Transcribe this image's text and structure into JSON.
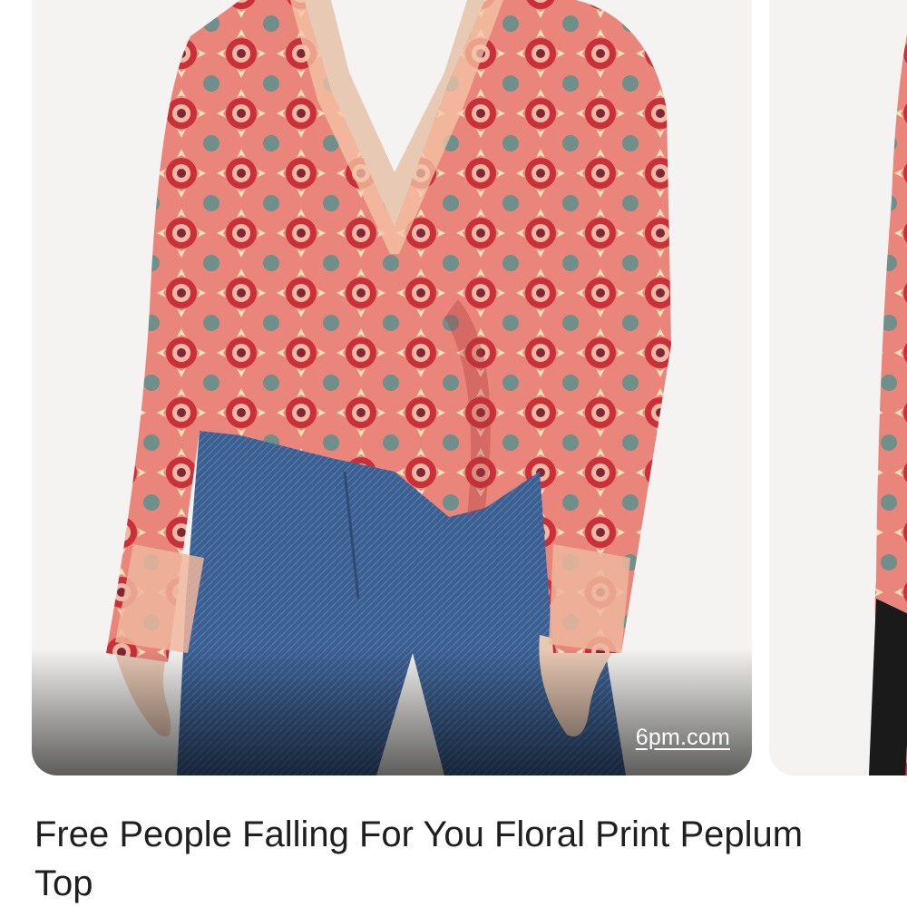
{
  "result": {
    "source": "6pm.com",
    "title": "Free People Falling For You Floral Print Peplum Top",
    "image_subject": "model wearing a red floral print peplum top with blue jeans"
  },
  "colors": {
    "card_background": "#f4f3f1",
    "title_text": "#1f1f1f",
    "overlay_text": "#ffffff"
  }
}
